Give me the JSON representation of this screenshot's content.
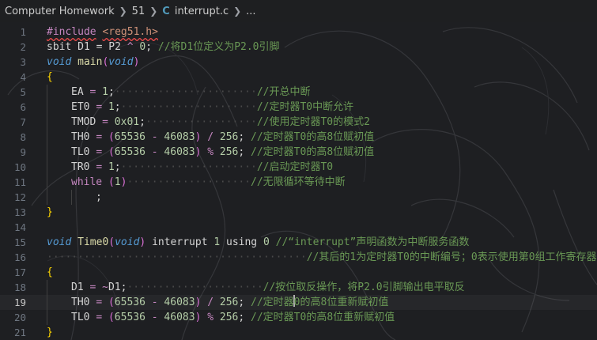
{
  "breadcrumb": {
    "folder": "Computer Homework",
    "subfolder": "51",
    "file_icon": "C",
    "file": "interrupt.c",
    "more": "..."
  },
  "colors": {
    "keyword": "#569cd6",
    "preprocessor": "#c586c0",
    "string": "#ce9178",
    "function": "#dcdcaa",
    "number": "#b5cea8",
    "comment": "#6a9955",
    "brace": "#ffd700"
  },
  "editor": {
    "current_line": 19,
    "lines": [
      {
        "n": "1",
        "indent": 0,
        "tokens": [
          [
            "kw-pp squiggle",
            "#include"
          ],
          [
            "kw-plain",
            " "
          ],
          [
            "kw-str squiggle",
            "<reg51.h>"
          ]
        ]
      },
      {
        "n": "2",
        "indent": 0,
        "tokens": [
          [
            "kw-plain",
            "sbit D1 = P2 "
          ],
          [
            "kw-opv",
            "^"
          ],
          [
            "kw-plain",
            " "
          ],
          [
            "kw-num",
            "0"
          ],
          [
            "kw-plain",
            "; "
          ],
          [
            "cmt",
            "//将D1位定义为P2.0引脚"
          ]
        ]
      },
      {
        "n": "3",
        "indent": 0,
        "tokens": [
          [
            "kw-type",
            "void"
          ],
          [
            "kw-plain",
            " "
          ],
          [
            "kw-fn",
            "main"
          ],
          [
            "paren2",
            "("
          ],
          [
            "kw-type",
            "void"
          ],
          [
            "paren2",
            ")"
          ]
        ]
      },
      {
        "n": "4",
        "indent": 0,
        "tokens": [
          [
            "brace",
            "{"
          ]
        ]
      },
      {
        "n": "5",
        "indent": 1,
        "tokens": [
          [
            "kw-plain",
            "EA "
          ],
          [
            "kw-opv",
            "="
          ],
          [
            "kw-plain",
            " "
          ],
          [
            "kw-num",
            "1"
          ],
          [
            "kw-plain",
            ";"
          ],
          [
            "ws",
            "·······················"
          ],
          [
            "cmt",
            "//开总中断"
          ]
        ]
      },
      {
        "n": "6",
        "indent": 1,
        "tokens": [
          [
            "kw-plain",
            "ET0 "
          ],
          [
            "kw-opv",
            "="
          ],
          [
            "kw-plain",
            " "
          ],
          [
            "kw-num",
            "1"
          ],
          [
            "kw-plain",
            ";"
          ],
          [
            "ws",
            "······················"
          ],
          [
            "cmt",
            "//定时器T0中断允许"
          ]
        ]
      },
      {
        "n": "7",
        "indent": 1,
        "tokens": [
          [
            "kw-plain",
            "TMOD "
          ],
          [
            "kw-opv",
            "="
          ],
          [
            "kw-plain",
            " "
          ],
          [
            "kw-num",
            "0x01"
          ],
          [
            "kw-plain",
            ";"
          ],
          [
            "ws",
            "··················"
          ],
          [
            "cmt",
            "//使用定时器T0的模式2"
          ]
        ]
      },
      {
        "n": "8",
        "indent": 1,
        "tokens": [
          [
            "kw-plain",
            "TH0 "
          ],
          [
            "kw-opv",
            "="
          ],
          [
            "kw-plain",
            " "
          ],
          [
            "paren2",
            "("
          ],
          [
            "kw-num",
            "65536"
          ],
          [
            "kw-plain",
            " "
          ],
          [
            "kw-opv",
            "-"
          ],
          [
            "kw-plain",
            " "
          ],
          [
            "kw-num",
            "46083"
          ],
          [
            "paren2",
            ")"
          ],
          [
            "kw-plain",
            " "
          ],
          [
            "kw-opv",
            "/"
          ],
          [
            "kw-plain",
            " "
          ],
          [
            "kw-num",
            "256"
          ],
          [
            "kw-plain",
            "; "
          ],
          [
            "cmt",
            "//定时器T0的高8位赋初值"
          ]
        ]
      },
      {
        "n": "9",
        "indent": 1,
        "tokens": [
          [
            "kw-plain",
            "TL0 "
          ],
          [
            "kw-opv",
            "="
          ],
          [
            "kw-plain",
            " "
          ],
          [
            "paren2",
            "("
          ],
          [
            "kw-num",
            "65536"
          ],
          [
            "kw-plain",
            " "
          ],
          [
            "kw-opv",
            "-"
          ],
          [
            "kw-plain",
            " "
          ],
          [
            "kw-num",
            "46083"
          ],
          [
            "paren2",
            ")"
          ],
          [
            "kw-plain",
            " "
          ],
          [
            "kw-opv",
            "%"
          ],
          [
            "kw-plain",
            " "
          ],
          [
            "kw-num",
            "256"
          ],
          [
            "kw-plain",
            "; "
          ],
          [
            "cmt",
            "//定时器T0的高8位赋初值"
          ]
        ]
      },
      {
        "n": "10",
        "indent": 1,
        "tokens": [
          [
            "kw-plain",
            "TR0 "
          ],
          [
            "kw-opv",
            "="
          ],
          [
            "kw-plain",
            " "
          ],
          [
            "kw-num",
            "1"
          ],
          [
            "kw-plain",
            ";"
          ],
          [
            "ws",
            "······················"
          ],
          [
            "cmt",
            "//启动定时器T0"
          ]
        ]
      },
      {
        "n": "11",
        "indent": 1,
        "tokens": [
          [
            "kw-ctrl",
            "while"
          ],
          [
            "kw-plain",
            " "
          ],
          [
            "paren2",
            "("
          ],
          [
            "kw-num",
            "1"
          ],
          [
            "paren2",
            ")"
          ],
          [
            "ws",
            "····················"
          ],
          [
            "cmt",
            "//无限循环等待中断"
          ]
        ]
      },
      {
        "n": "12",
        "indent": 2,
        "tokens": [
          [
            "kw-plain",
            ";"
          ]
        ]
      },
      {
        "n": "13",
        "indent": 0,
        "tokens": [
          [
            "brace",
            "}"
          ]
        ]
      },
      {
        "n": "14",
        "indent": 0,
        "tokens": []
      },
      {
        "n": "15",
        "indent": 0,
        "tokens": [
          [
            "kw-type",
            "void"
          ],
          [
            "kw-plain",
            " "
          ],
          [
            "kw-fn",
            "Time0"
          ],
          [
            "paren2",
            "("
          ],
          [
            "kw-type",
            "void"
          ],
          [
            "paren2",
            ")"
          ],
          [
            "kw-plain",
            " interrupt "
          ],
          [
            "kw-num",
            "1"
          ],
          [
            "kw-plain",
            " using "
          ],
          [
            "kw-num",
            "0"
          ],
          [
            "kw-plain",
            " "
          ],
          [
            "cmt",
            "//“interrupt”声明函数为中断服务函数"
          ]
        ]
      },
      {
        "n": "16",
        "indent": 0,
        "tokens": [
          [
            "ws",
            "··········································"
          ],
          [
            "cmt",
            "//其后的1为定时器T0的中断编号；0表示使用第0组工作寄存器"
          ]
        ]
      },
      {
        "n": "17",
        "indent": 0,
        "tokens": [
          [
            "brace",
            "{"
          ]
        ]
      },
      {
        "n": "18",
        "indent": 1,
        "tokens": [
          [
            "kw-plain",
            "D1 "
          ],
          [
            "kw-opv",
            "="
          ],
          [
            "kw-plain",
            " "
          ],
          [
            "kw-opv",
            "~"
          ],
          [
            "kw-plain",
            "D1;"
          ],
          [
            "ws",
            "······················"
          ],
          [
            "cmt",
            "//按位取反操作，将P2.0引脚输出电平取反"
          ]
        ]
      },
      {
        "n": "19",
        "indent": 1,
        "tokens": [
          [
            "kw-plain",
            "TH0 "
          ],
          [
            "kw-opv",
            "="
          ],
          [
            "kw-plain",
            " "
          ],
          [
            "paren2",
            "("
          ],
          [
            "kw-num",
            "65536"
          ],
          [
            "kw-plain",
            " "
          ],
          [
            "kw-opv",
            "-"
          ],
          [
            "kw-plain",
            " "
          ],
          [
            "kw-num",
            "46083"
          ],
          [
            "paren2",
            ")"
          ],
          [
            "kw-plain",
            " "
          ],
          [
            "kw-opv",
            "/"
          ],
          [
            "kw-plain",
            " "
          ],
          [
            "kw-num",
            "256"
          ],
          [
            "kw-plain",
            "; "
          ],
          [
            "cmt",
            "//定时器"
          ],
          [
            "cursor",
            ""
          ],
          [
            "cmt",
            "0的高8位重新赋初值"
          ]
        ]
      },
      {
        "n": "20",
        "indent": 1,
        "tokens": [
          [
            "kw-plain",
            "TL0 "
          ],
          [
            "kw-opv",
            "="
          ],
          [
            "kw-plain",
            " "
          ],
          [
            "paren2",
            "("
          ],
          [
            "kw-num",
            "65536"
          ],
          [
            "kw-plain",
            " "
          ],
          [
            "kw-opv",
            "-"
          ],
          [
            "kw-plain",
            " "
          ],
          [
            "kw-num",
            "46083"
          ],
          [
            "paren2",
            ")"
          ],
          [
            "kw-plain",
            " "
          ],
          [
            "kw-opv",
            "%"
          ],
          [
            "kw-plain",
            " "
          ],
          [
            "kw-num",
            "256"
          ],
          [
            "kw-plain",
            "; "
          ],
          [
            "cmt",
            "//定时器T0的高8位重新赋初值"
          ]
        ]
      },
      {
        "n": "21",
        "indent": 0,
        "tokens": [
          [
            "brace",
            "}"
          ]
        ]
      }
    ]
  }
}
